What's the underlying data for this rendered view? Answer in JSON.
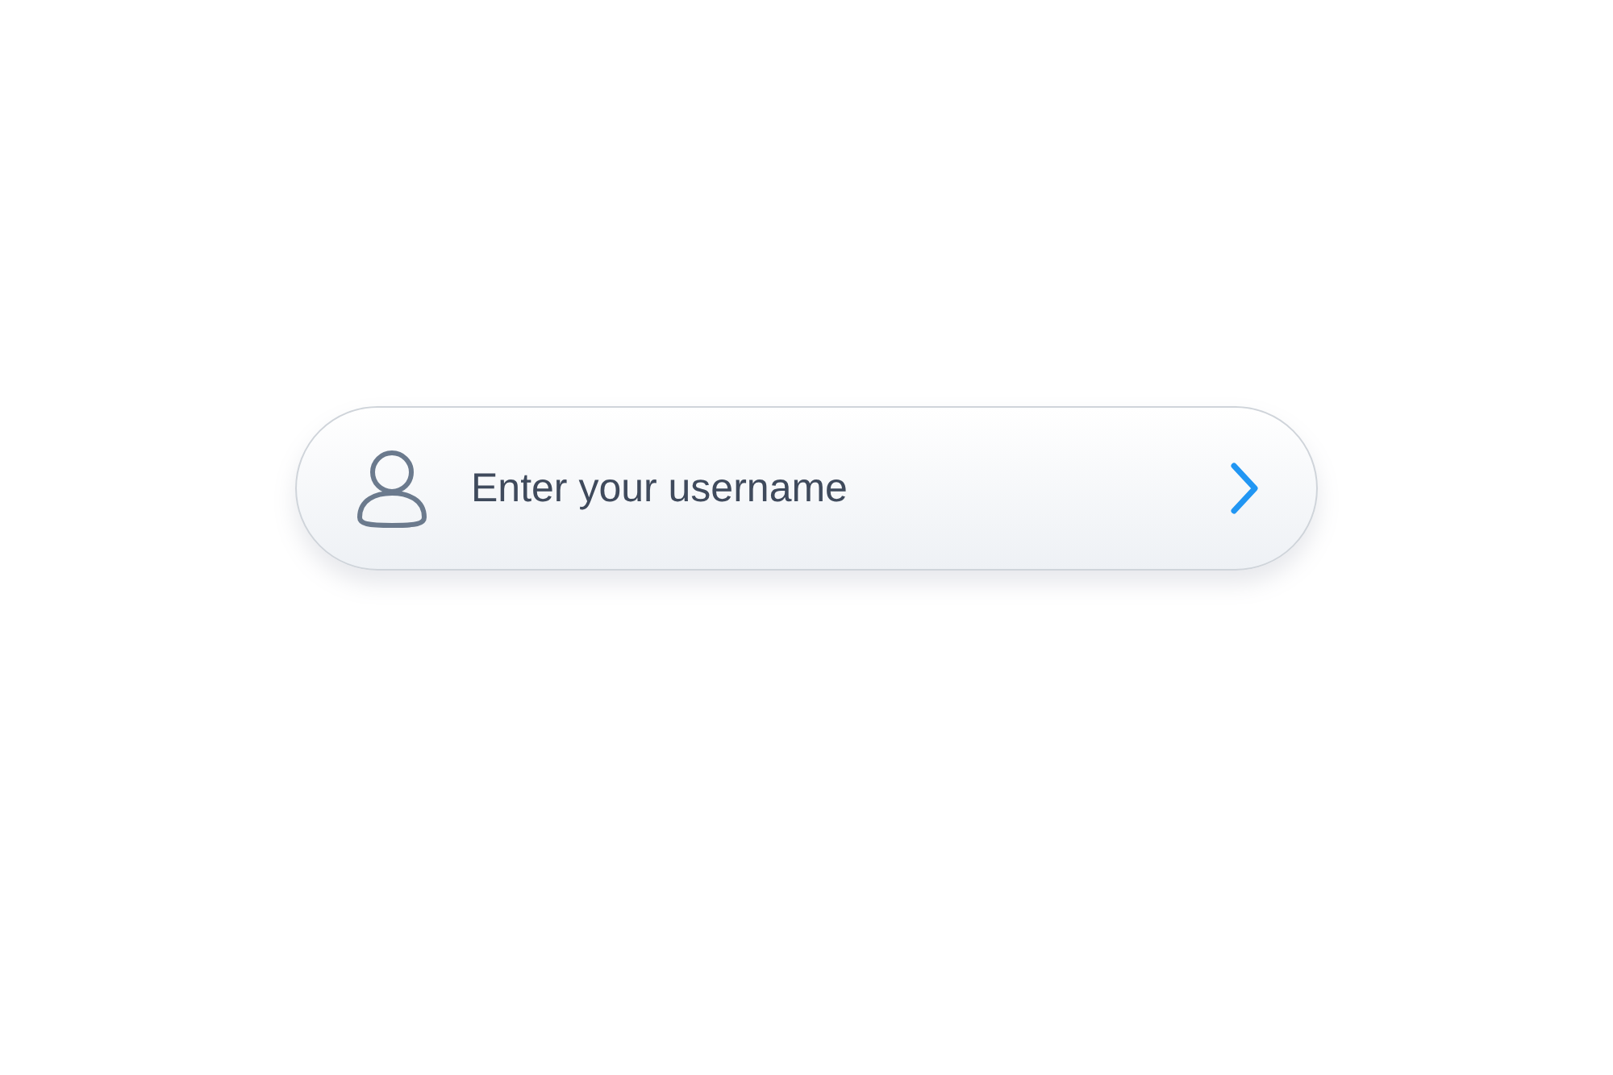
{
  "username_field": {
    "placeholder": "Enter your username"
  }
}
